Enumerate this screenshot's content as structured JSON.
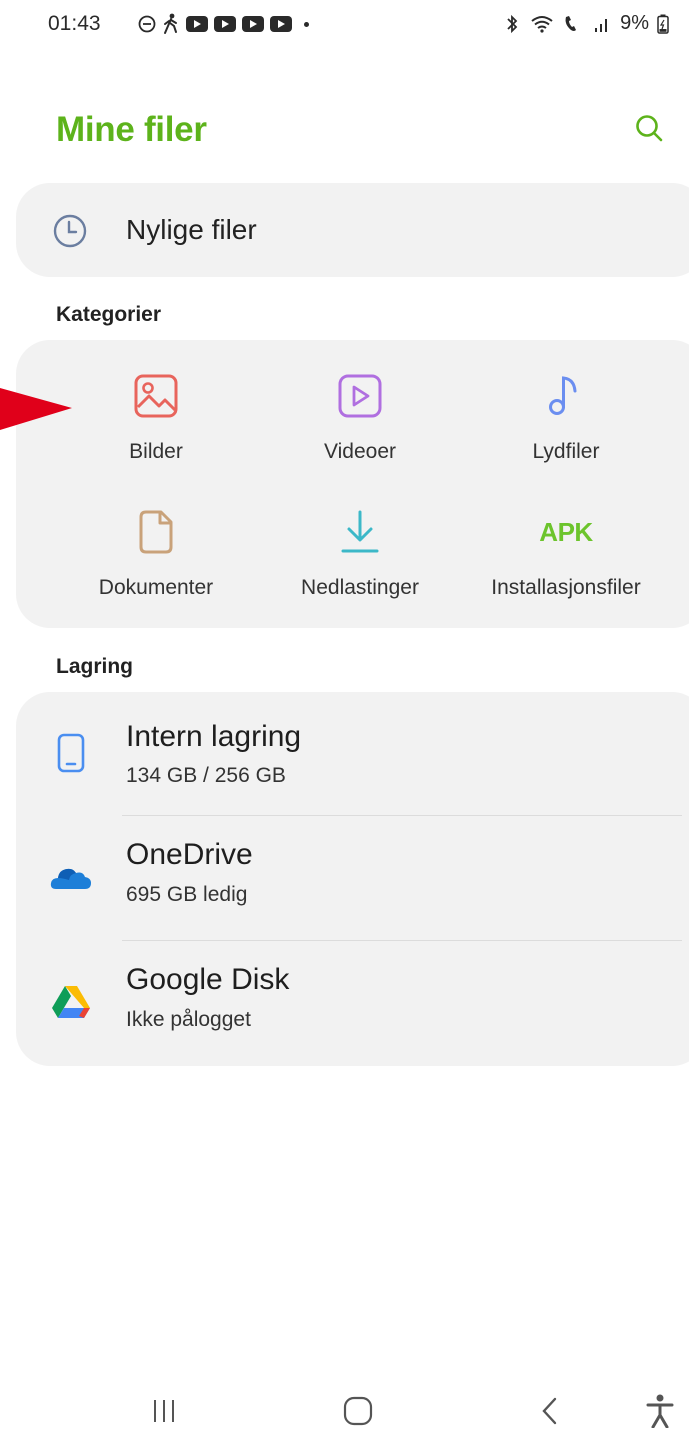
{
  "status_bar": {
    "time": "01:43",
    "battery": "9%"
  },
  "header": {
    "title": "Mine filer",
    "search_icon": "search-icon"
  },
  "recent": {
    "label": "Nylige filer",
    "icon": "clock-icon"
  },
  "categories": {
    "heading": "Kategorier",
    "items": [
      {
        "label": "Bilder",
        "icon": "image-icon",
        "color": "#e8645c"
      },
      {
        "label": "Videoer",
        "icon": "video-icon",
        "color": "#b06fe0"
      },
      {
        "label": "Lydfiler",
        "icon": "music-note-icon",
        "color": "#6b8ef0"
      },
      {
        "label": "Dokumenter",
        "icon": "document-icon",
        "color": "#c9a27a"
      },
      {
        "label": "Nedlastinger",
        "icon": "download-icon",
        "color": "#3cb8c8"
      },
      {
        "label": "Installasjonsfiler",
        "icon": "apk-icon",
        "icon_text": "APK",
        "color": "#6cc42c"
      }
    ]
  },
  "storage": {
    "heading": "Lagring",
    "items": [
      {
        "name": "Intern lagring",
        "sub": "134 GB / 256 GB",
        "icon": "phone-icon"
      },
      {
        "name": "OneDrive",
        "sub": "695 GB ledig",
        "icon": "onedrive-icon"
      },
      {
        "name": "Google Disk",
        "sub": "Ikke pålogget",
        "icon": "google-drive-icon"
      }
    ]
  },
  "colors": {
    "accent": "#5db31b",
    "card_bg": "#f2f2f2",
    "annotation_arrow": "#e0001a"
  },
  "navigation": {
    "buttons": [
      "recent-apps-icon",
      "home-icon",
      "back-icon",
      "accessibility-icon"
    ]
  }
}
